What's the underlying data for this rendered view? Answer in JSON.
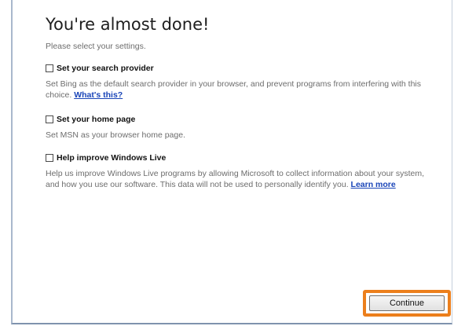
{
  "page": {
    "title": "You're almost done!",
    "subtitle": "Please select your settings."
  },
  "options": [
    {
      "label": "Set your search provider",
      "checked": false,
      "description": "Set Bing as the default search provider in your browser, and prevent programs from interfering with this choice.",
      "link": "What's this?"
    },
    {
      "label": "Set your home page",
      "checked": false,
      "description": "Set MSN as your browser home page.",
      "link": ""
    },
    {
      "label": "Help improve Windows Live",
      "checked": false,
      "description": "Help us improve Windows Live programs by allowing Microsoft to collect information about your system, and how you use our software. This data will not be used to personally identify you.",
      "link": "Learn more"
    }
  ],
  "footer": {
    "continue_label": "Continue"
  },
  "colors": {
    "link": "#1a45b8",
    "highlight": "#ec7f1c"
  }
}
